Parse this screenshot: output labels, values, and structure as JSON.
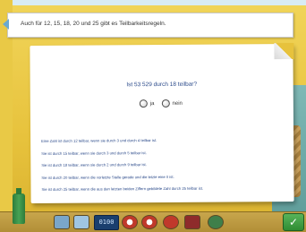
{
  "banner": {
    "text": "Auch für 12, 15, 18, 20 und 25 gibt es Teilbarkeitsregeln."
  },
  "question": {
    "text": "Ist 53 529 durch 18 teilbar?"
  },
  "answers": [
    {
      "label": "ja"
    },
    {
      "label": "nein"
    }
  ],
  "rules": [
    "Eine Zahl ist durch 12 teilbar, wenn sie durch 3 und durch 4 teilbar ist.",
    "Sie ist durch 15 teilbar, wenn sie durch 3 und durch 5 teilbar ist.",
    "Sie ist durch 18 teilbar, wenn sie durch 2 und durch 9 teilbar ist.",
    "Sie ist durch 20 teilbar, wenn die vorletzte Stelle gerade und die letzte eine 0 ist.",
    "Sie ist durch 25 teilbar, wenn die aus den letzten beiden Ziffern gebildete Zahl durch 25 teilbar ist."
  ],
  "toolbar": {
    "clock": "0100",
    "icons": [
      "bottle-icon",
      "toolbar-icon-1",
      "toolbar-icon-2",
      "clock-display",
      "toolbar-icon-3",
      "toolbar-icon-4",
      "toolbar-icon-5",
      "toolbar-icon-6",
      "toolbar-icon-7",
      "check-button"
    ]
  },
  "colors": {
    "accent": "#2b4a8a",
    "background": "#e7c23c",
    "check": "#2f8c33"
  }
}
